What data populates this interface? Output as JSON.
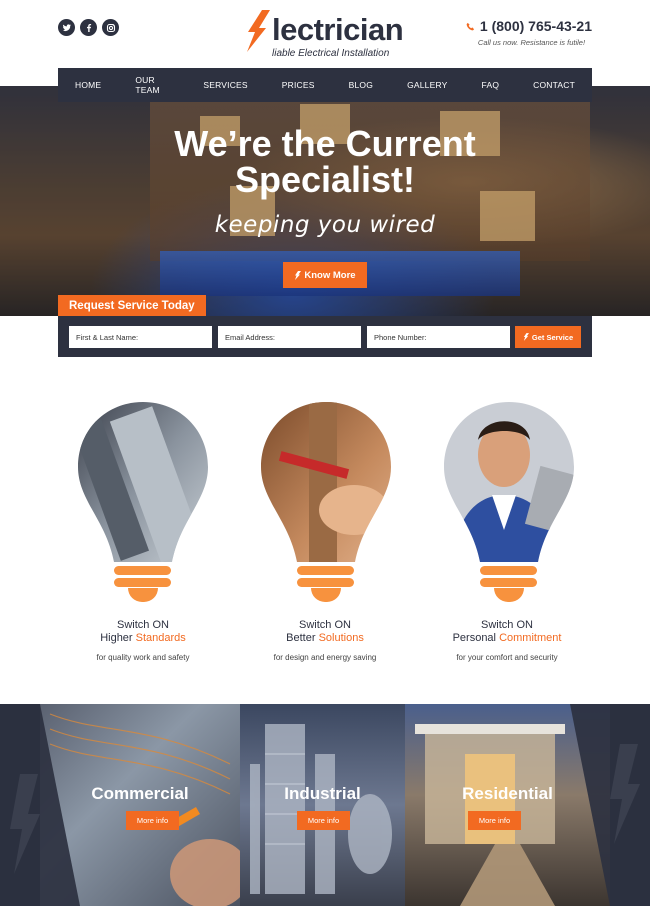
{
  "header": {
    "social": [
      "twitter-icon",
      "facebook-icon",
      "instagram-icon"
    ],
    "logo_name": "lectrician",
    "logo_tagline": "liable Electrical Installation",
    "phone": "1 (800) 765-43-21",
    "phone_note": "Call us now. Resistance is futile!"
  },
  "nav": {
    "items": [
      "HOME",
      "OUR TEAM",
      "SERVICES",
      "PRICES",
      "BLOG",
      "GALLERY",
      "FAQ",
      "CONTACT"
    ]
  },
  "hero": {
    "title_line1": "We’re the Current",
    "title_line2": "Specialist!",
    "subtitle": "keeping you wired",
    "button": "Know More"
  },
  "request": {
    "tab_label": "Request Service Today",
    "name_placeholder": "First & Last Name:",
    "email_placeholder": "Email Address:",
    "phone_placeholder": "Phone Number:",
    "submit": "Get Service"
  },
  "features": [
    {
      "line1": "Switch ON",
      "line2_prefix": "Higher ",
      "line2_accent": "Standards",
      "desc": "for quality work and safety"
    },
    {
      "line1": "Switch ON",
      "line2_prefix": "Better ",
      "line2_accent": "Solutions",
      "desc": "for design and energy saving"
    },
    {
      "line1": "Switch ON",
      "line2_prefix": "Personal ",
      "line2_accent": "Commitment",
      "desc": "for your comfort and security"
    }
  ],
  "categories": [
    {
      "title": "Commercial",
      "button": "More info"
    },
    {
      "title": "Industrial",
      "button": "More info"
    },
    {
      "title": "Residential",
      "button": "More info"
    }
  ],
  "colors": {
    "accent": "#f26a21",
    "dark": "#2d3140",
    "bulb_base": "#f7923e"
  }
}
